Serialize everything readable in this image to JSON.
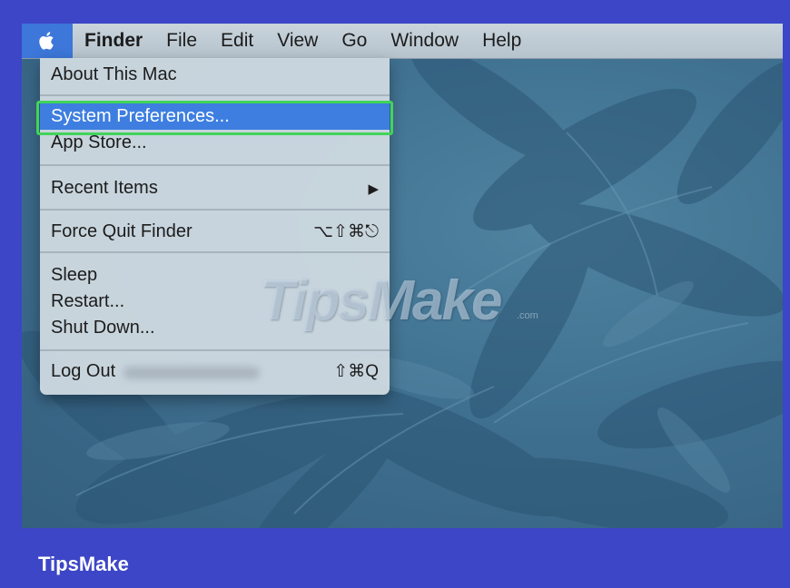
{
  "menubar": {
    "apple_icon": "apple-icon",
    "items": [
      "Finder",
      "File",
      "Edit",
      "View",
      "Go",
      "Window",
      "Help"
    ]
  },
  "apple_menu": {
    "about": "About This Mac",
    "system_prefs": "System Preferences...",
    "app_store": "App Store...",
    "recent_items": "Recent Items",
    "recent_items_arrow": "▶",
    "force_quit": "Force Quit Finder",
    "force_quit_shortcut": "⌥⇧⌘⎋",
    "sleep": "Sleep",
    "restart": "Restart...",
    "shut_down": "Shut Down...",
    "log_out": "Log Out",
    "log_out_shortcut": "⇧⌘Q"
  },
  "watermark": {
    "text": "TipsMake",
    "suffix": ".com"
  },
  "brand": "TipsMake",
  "colors": {
    "frame": "#3c46c6",
    "highlight": "#3d7ee0",
    "annotation_box": "#40d45a"
  }
}
